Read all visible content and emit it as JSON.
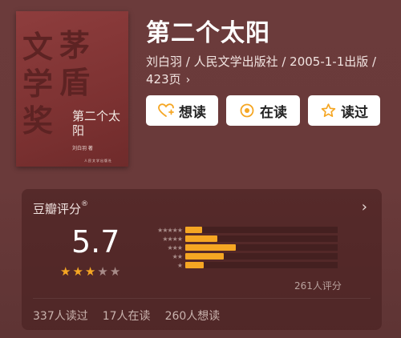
{
  "book": {
    "title": "第二个太阳",
    "meta": "刘白羽 / 人民文学出版社 / 2005-1-1出版 / 423页",
    "cover": {
      "watermark_col1": "文学奖",
      "watermark_col2": "茅盾",
      "title": "第二个太阳",
      "author": "刘白羽 著",
      "publisher": "人民文学出版社"
    }
  },
  "actions": {
    "want": "想读",
    "reading": "在读",
    "read": "读过"
  },
  "rating": {
    "label": "豆瓣评分",
    "reg_mark": "®",
    "score": "5.7",
    "stars_on": 3,
    "stars_total": 5,
    "distribution": [
      {
        "stars": "★★★★★",
        "fraction": 0.11
      },
      {
        "stars": "★★★★",
        "fraction": 0.21
      },
      {
        "stars": "★★★",
        "fraction": 0.33
      },
      {
        "stars": "★★",
        "fraction": 0.25
      },
      {
        "stars": "★",
        "fraction": 0.12
      }
    ],
    "count": "261人评分"
  },
  "stats": {
    "read": "337人读过",
    "reading": "17人在读",
    "want": "260人想读"
  },
  "colors": {
    "accent": "#f5a623",
    "background": "#6b3b3b"
  }
}
